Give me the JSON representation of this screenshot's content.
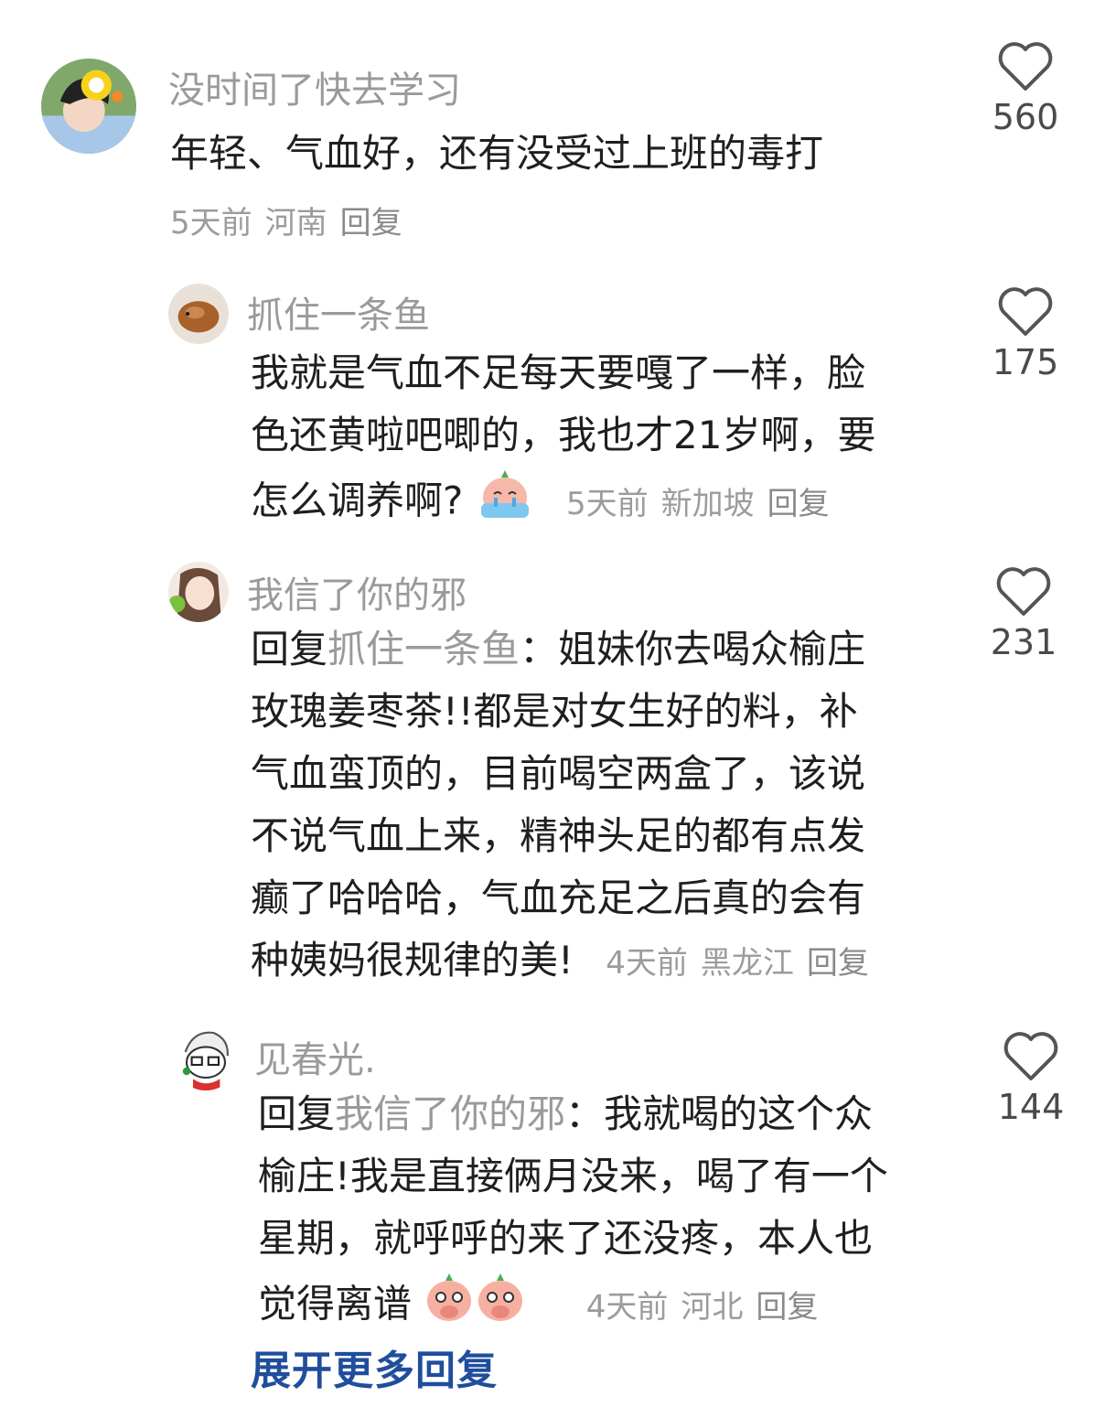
{
  "comments": [
    {
      "username": "没时间了快去学习",
      "text_lines": [
        "年轻、气血好，还有没受过上班的毒打"
      ],
      "time": "5天前",
      "location": "河南",
      "reply_label": "回复",
      "likes": "560",
      "avatar": "avatar-photo-girl-yellow"
    },
    {
      "username": "抓住一条鱼",
      "text_lines": [
        "我就是气血不足每天要嘎了一样，脸",
        "色还黄啦吧唧的，我也才21岁啊，要",
        "怎么调养啊?"
      ],
      "emoji": "crying-peach-emoji",
      "time": "5天前",
      "location": "新加坡",
      "reply_label": "回复",
      "likes": "175",
      "avatar": "avatar-guinea-pig"
    },
    {
      "username": "我信了你的邪",
      "reply_prefix": "回复",
      "reply_target": "抓住一条鱼",
      "reply_colon": "：",
      "text_lines": [
        "姐妹你去喝众榆庄",
        "玫瑰姜枣茶!!都是对女生好的料，补",
        "气血蛮顶的，目前喝空两盒了，该说",
        "不说气血上来，精神头足的都有点发",
        "癫了哈哈哈，气血充足之后真的会有",
        "种姨妈很规律的美!"
      ],
      "time": "4天前",
      "location": "黑龙江",
      "reply_label": "回复",
      "likes": "231",
      "avatar": "avatar-girl-green-apple"
    },
    {
      "username": "见春光.",
      "reply_prefix": "回复",
      "reply_target": "我信了你的邪",
      "reply_colon": "：",
      "text_lines": [
        "我就喝的这个众",
        "榆庄!我是直接俩月没来，喝了有一个",
        "星期，就呼呼的来了还没疼，本人也",
        "觉得离谱"
      ],
      "emoji": "shy-peach-emoji",
      "time": "4天前",
      "location": "河北",
      "reply_label": "回复",
      "likes": "144",
      "avatar": "avatar-cartoon-glasses"
    }
  ],
  "expand_more": "展开更多回复",
  "colors": {
    "link": "#1f4e9c",
    "muted": "#9a9a9a",
    "text": "#1f1f1f"
  }
}
